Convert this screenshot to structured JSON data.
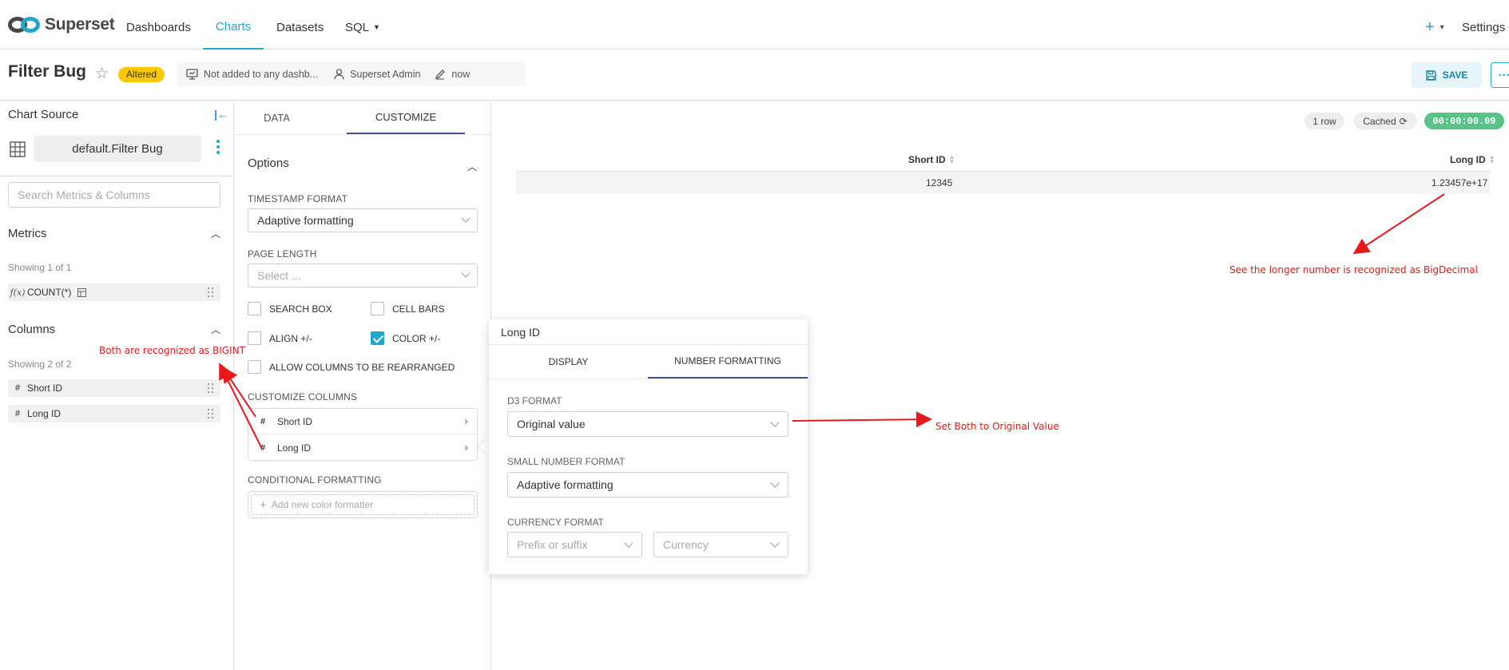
{
  "nav": {
    "brand": "Superset",
    "items": [
      {
        "label": "Dashboards",
        "active": false
      },
      {
        "label": "Charts",
        "active": true
      },
      {
        "label": "Datasets",
        "active": false
      },
      {
        "label": "SQL",
        "active": false
      }
    ],
    "plus_label": "+",
    "settings_label": "Settings"
  },
  "header": {
    "title": "Filter Bug",
    "badge": "Altered",
    "dashboards_text": "Not added to any dashb...",
    "owner_text": "Superset Admin",
    "modified_text": "now",
    "save_label": "SAVE",
    "more_label": "···"
  },
  "left_panel": {
    "title": "Chart Source",
    "dataset": "default.Filter Bug",
    "search_placeholder": "Search Metrics & Columns",
    "metrics": {
      "title": "Metrics",
      "showing": "Showing 1 of 1",
      "items": [
        {
          "icon": "f(x)",
          "label": "COUNT(*)"
        }
      ]
    },
    "columns": {
      "title": "Columns",
      "showing": "Showing 2 of 2",
      "items": [
        {
          "icon": "#",
          "label": "Short ID"
        },
        {
          "icon": "#",
          "label": "Long ID"
        }
      ]
    }
  },
  "mid_panel": {
    "tabs": [
      {
        "label": "DATA",
        "active": false
      },
      {
        "label": "CUSTOMIZE",
        "active": true
      }
    ],
    "options_title": "Options",
    "timestamp_label": "TIMESTAMP FORMAT",
    "timestamp_value": "Adaptive formatting",
    "page_length_label": "PAGE LENGTH",
    "page_length_placeholder": "Select ...",
    "checkboxes": [
      {
        "label": "SEARCH BOX",
        "checked": false
      },
      {
        "label": "CELL BARS",
        "checked": false
      },
      {
        "label": "ALIGN +/-",
        "checked": false
      },
      {
        "label": "COLOR +/-",
        "checked": true
      },
      {
        "label": "ALLOW COLUMNS TO BE REARRANGED",
        "checked": false
      }
    ],
    "customize_columns_label": "CUSTOMIZE COLUMNS",
    "columns": [
      {
        "icon": "#",
        "label": "Short ID"
      },
      {
        "icon": "#",
        "label": "Long ID"
      }
    ],
    "conditional_label": "CONDITIONAL FORMATTING",
    "add_formatter": "Add new color formatter"
  },
  "popover": {
    "title": "Long ID",
    "tabs": [
      {
        "label": "DISPLAY",
        "active": false
      },
      {
        "label": "NUMBER FORMATTING",
        "active": true
      }
    ],
    "d3_label": "D3 FORMAT",
    "d3_value": "Original value",
    "small_label": "SMALL NUMBER FORMAT",
    "small_value": "Adaptive formatting",
    "currency_label": "CURRENCY FORMAT",
    "prefix_placeholder": "Prefix or suffix",
    "currency_placeholder": "Currency"
  },
  "results": {
    "row_count": "1 row",
    "cached": "Cached",
    "timer": "00:00:00.09",
    "columns": [
      "Short ID",
      "Long ID"
    ],
    "rows": [
      [
        "12345",
        "1.23457e+17"
      ]
    ]
  },
  "annotations": {
    "bigint": "Both are recognized as BIGINT",
    "bigdecimal": "See the longer number is recognized as BigDecimal",
    "original": "Set Both to Original Value"
  },
  "colors": {
    "accent": "#20a7c9",
    "badge": "#fbc700",
    "timer": "#5ac189",
    "annotation": "#e8191b",
    "tab_indicator": "#484f8e"
  }
}
